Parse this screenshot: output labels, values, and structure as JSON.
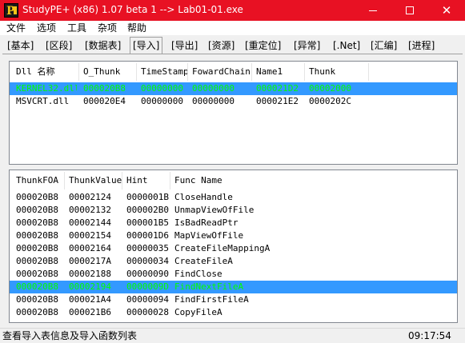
{
  "window": {
    "title": "StudyPE+ (x86) 1.07 beta 1  --> Lab01-01.exe",
    "icon": "studype-app-icon",
    "min_glyph": "",
    "max_glyph": "",
    "close_glyph": "✕",
    "titlebar_color": "#e81123"
  },
  "menu": {
    "items": [
      {
        "label": "文件"
      },
      {
        "label": "选项"
      },
      {
        "label": "工具"
      },
      {
        "label": "杂项"
      },
      {
        "label": "帮助"
      }
    ]
  },
  "tabs": {
    "items": [
      {
        "label": "[基本]"
      },
      {
        "label": "[区段]"
      },
      {
        "label": "[数据表]"
      },
      {
        "label": "[导入]",
        "active": true
      },
      {
        "label": "[导出]"
      },
      {
        "label": "[资源]"
      },
      {
        "label": "[重定位]"
      },
      {
        "label": "[异常]"
      },
      {
        "label": "[.Net]"
      },
      {
        "label": "[汇编]"
      },
      {
        "label": "[进程]"
      }
    ]
  },
  "dll_table": {
    "columns": [
      "Dll 名称",
      "O_Thunk",
      "TimeStamp",
      "FowardChain",
      "Name1",
      "Thunk"
    ],
    "rows": [
      {
        "cells": [
          "KERNEL32.dll",
          "000020B8",
          "00000000",
          "00000000",
          "000021D2",
          "00002000"
        ],
        "selected": true
      },
      {
        "cells": [
          "MSVCRT.dll",
          "000020E4",
          "00000000",
          "00000000",
          "000021E2",
          "0000202C"
        ],
        "selected": false
      }
    ]
  },
  "func_table": {
    "columns": [
      "ThunkFOA",
      "ThunkValue",
      "Hint",
      "Func Name"
    ],
    "rows": [
      {
        "cells": [
          "000020B8",
          "00002124",
          "0000001B",
          "CloseHandle"
        ],
        "selected": false
      },
      {
        "cells": [
          "000020B8",
          "00002132",
          "000002B0",
          "UnmapViewOfFile"
        ],
        "selected": false
      },
      {
        "cells": [
          "000020B8",
          "00002144",
          "000001B5",
          "IsBadReadPtr"
        ],
        "selected": false
      },
      {
        "cells": [
          "000020B8",
          "00002154",
          "000001D6",
          "MapViewOfFile"
        ],
        "selected": false
      },
      {
        "cells": [
          "000020B8",
          "00002164",
          "00000035",
          "CreateFileMappingA"
        ],
        "selected": false
      },
      {
        "cells": [
          "000020B8",
          "0000217A",
          "00000034",
          "CreateFileA"
        ],
        "selected": false
      },
      {
        "cells": [
          "000020B8",
          "00002188",
          "00000090",
          "FindClose"
        ],
        "selected": false
      },
      {
        "cells": [
          "000020B8",
          "00002194",
          "0000009D",
          "FindNextFileA"
        ],
        "selected": true
      },
      {
        "cells": [
          "000020B8",
          "000021A4",
          "00000094",
          "FindFirstFileA"
        ],
        "selected": false
      },
      {
        "cells": [
          "000020B8",
          "000021B6",
          "00000028",
          "CopyFileA"
        ],
        "selected": false
      }
    ]
  },
  "status": {
    "text": "查看导入表信息及导入函数列表",
    "time": "09:17:54"
  },
  "colors": {
    "selection_bg": "#3399ff",
    "selection_text": "#00ff00"
  }
}
